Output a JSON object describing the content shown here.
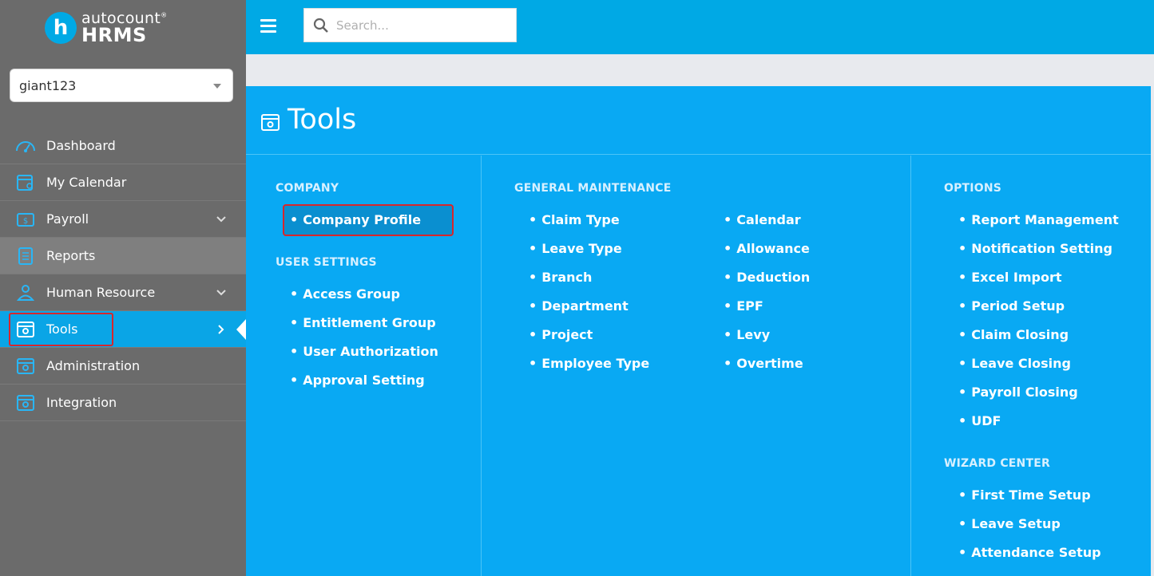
{
  "brand": {
    "top": "autocount",
    "bottom": "HRMS",
    "mark": "h"
  },
  "company_select": {
    "value": "giant123"
  },
  "search": {
    "placeholder": "Search..."
  },
  "nav": {
    "dashboard": "Dashboard",
    "calendar": "My Calendar",
    "payroll": "Payroll",
    "reports": "Reports",
    "hr": "Human Resource",
    "tools": "Tools",
    "administration": "Administration",
    "integration": "Integration"
  },
  "panel": {
    "title": "Tools",
    "company": {
      "title": "COMPANY",
      "items": [
        "Company Profile"
      ]
    },
    "user_settings": {
      "title": "USER SETTINGS",
      "items": [
        "Access Group",
        "Entitlement Group",
        "User Authorization",
        "Approval Setting"
      ]
    },
    "general": {
      "title": "GENERAL MAINTENANCE",
      "col1": [
        "Claim Type",
        "Leave Type",
        "Branch",
        "Department",
        "Project",
        "Employee Type"
      ],
      "col2": [
        "Calendar",
        "Allowance",
        "Deduction",
        "EPF",
        "Levy",
        "Overtime"
      ]
    },
    "options": {
      "title": "OPTIONS",
      "items": [
        "Report Management",
        "Notification Setting",
        "Excel Import",
        "Period Setup",
        "Claim Closing",
        "Leave Closing",
        "Payroll Closing",
        "UDF"
      ]
    },
    "wizard": {
      "title": "WIZARD CENTER",
      "items": [
        "First Time Setup",
        "Leave Setup",
        "Attendance Setup"
      ]
    }
  },
  "colors": {
    "sidebar": "#6b6b6b",
    "accent": "#00a9e5",
    "panel": "#09a9f3",
    "highlight": "#d8262b"
  }
}
